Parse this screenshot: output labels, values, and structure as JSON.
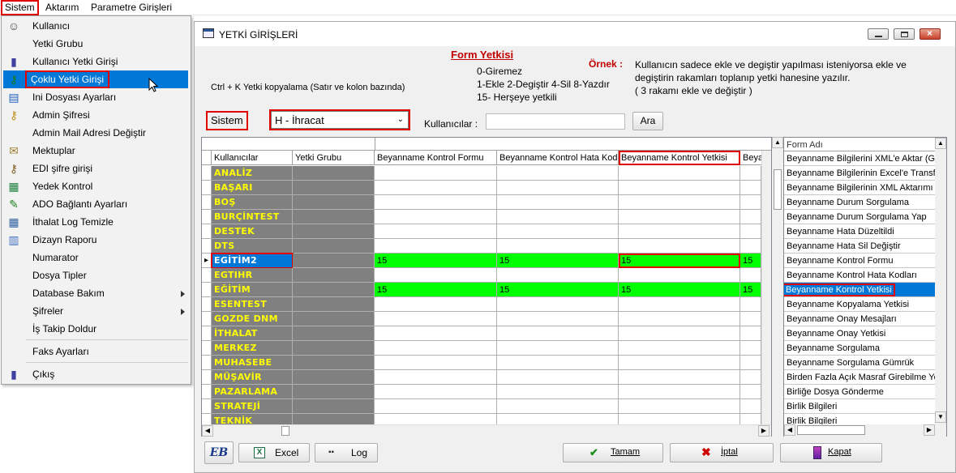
{
  "menubar": {
    "items": [
      "Sistem",
      "Aktarım",
      "Parametre Girişleri"
    ]
  },
  "dropdown": {
    "items": [
      {
        "label": "Kullanıcı",
        "icon": "user-icon"
      },
      {
        "label": "Yetki Grubu",
        "icon": ""
      },
      {
        "label": "Kullanıcı Yetki Girişi",
        "icon": "user-key-icon"
      },
      {
        "label": "Çoklu Yetki Girişi",
        "icon": "multi-key-icon"
      },
      {
        "label": "Ini Dosyası  Ayarları",
        "icon": "ini-file-icon"
      },
      {
        "label": "Admin Şifresi",
        "icon": "key-icon"
      },
      {
        "label": "Admin Mail Adresi Değiştir",
        "icon": ""
      },
      {
        "label": "Mektuplar",
        "icon": "mail-icon"
      },
      {
        "label": "EDI şifre girişi",
        "icon": "edi-key-icon"
      },
      {
        "label": "Yedek Kontrol",
        "icon": "backup-icon"
      },
      {
        "label": "ADO Bağlantı Ayarları",
        "icon": "connection-icon"
      },
      {
        "label": "İthalat Log Temizle",
        "icon": "log-clean-icon"
      },
      {
        "label": "Dizayn Raporu",
        "icon": "report-icon"
      },
      {
        "label": "Numarator",
        "icon": ""
      },
      {
        "label": "Dosya Tipler",
        "icon": ""
      },
      {
        "label": "Database Bakım",
        "icon": "",
        "submenu": true
      },
      {
        "label": "Şifreler",
        "icon": "",
        "submenu": true
      },
      {
        "label": "İş Takip Doldur",
        "icon": ""
      },
      {
        "label": "Faks Ayarları",
        "icon": ""
      },
      {
        "label": "Çıkış",
        "icon": "exit-icon"
      }
    ]
  },
  "window": {
    "title": "YETKİ GİRİŞLERİ",
    "form_yetkisi_title": "Form Yetkisi",
    "legend": [
      "0-Giremez",
      "1-Ekle  2-Degiştir  4-Sil  8-Yazdır",
      "15- Herşeye yetkili"
    ],
    "ornek_label": "Örnek :",
    "ornek_text_1": "Kullanıcın sadece ekle ve degiştir yapılması isteniyorsa  ekle ve",
    "ornek_text_2": "degiştirin rakamları toplanıp yetki hanesine yazılır.",
    "ornek_text_3": " ( 3 rakamı ekle ve değiştir )",
    "copy_hint": "Ctrl + K Yetki kopyalama (Satır ve kolon bazında)",
    "sistem_label": "Sistem",
    "module_value": "H - İhracat",
    "kullanicilar_label": "Kullanıcılar :",
    "kullanicilar_value": "",
    "ara_button": "Ara"
  },
  "grid": {
    "headers": [
      "Kullanıcılar",
      "Yetki Grubu",
      "Beyanname Kontrol Formu",
      "Beyanname Kontrol Hata Kodla",
      "Beyanname Kontrol Yetkisi",
      "Beyanı"
    ],
    "rows": [
      {
        "user": "ANALİZ",
        "vals": [
          "",
          "",
          "",
          ""
        ]
      },
      {
        "user": "BAŞARI",
        "vals": [
          "",
          "",
          "",
          ""
        ]
      },
      {
        "user": "BOŞ",
        "vals": [
          "",
          "",
          "",
          ""
        ]
      },
      {
        "user": "BURÇİNTEST",
        "vals": [
          "",
          "",
          "",
          ""
        ]
      },
      {
        "user": "DESTEK",
        "vals": [
          "",
          "",
          "",
          ""
        ]
      },
      {
        "user": "DTS",
        "vals": [
          "",
          "",
          "",
          ""
        ]
      },
      {
        "user": "EGİTİM2",
        "vals": [
          "15",
          "15",
          "15",
          "15"
        ],
        "selected": true
      },
      {
        "user": "EGTIHR",
        "vals": [
          "",
          "",
          "",
          ""
        ]
      },
      {
        "user": "EĞİTİM",
        "vals": [
          "15",
          "15",
          "15",
          "15"
        ]
      },
      {
        "user": "ESENTEST",
        "vals": [
          "",
          "",
          "",
          ""
        ]
      },
      {
        "user": "GOZDE DNM",
        "vals": [
          "",
          "",
          "",
          ""
        ]
      },
      {
        "user": "İTHALAT",
        "vals": [
          "",
          "",
          "",
          ""
        ]
      },
      {
        "user": "MERKEZ",
        "vals": [
          "",
          "",
          "",
          ""
        ]
      },
      {
        "user": "MUHASEBE",
        "vals": [
          "",
          "",
          "",
          ""
        ]
      },
      {
        "user": "MÜŞAVİR",
        "vals": [
          "",
          "",
          "",
          ""
        ]
      },
      {
        "user": "PAZARLAMA",
        "vals": [
          "",
          "",
          "",
          ""
        ]
      },
      {
        "user": "STRATEJİ",
        "vals": [
          "",
          "",
          "",
          ""
        ]
      },
      {
        "user": "TEKNİK",
        "vals": [
          "",
          "",
          "",
          ""
        ]
      }
    ]
  },
  "forms": {
    "header": "Form Adı",
    "items": [
      "Beyanname Bilgilerini XML'e Aktar (GE",
      "Beyanname Bilgilerinin Excel'e Transfer",
      "Beyanname Bilgilerinin XML Aktarımı (K",
      "Beyanname Durum Sorgulama",
      "Beyanname Durum Sorgulama Yap",
      "Beyanname Hata Düzeltildi",
      "Beyanname Hata Sil Değiştir",
      "Beyanname Kontrol Formu",
      "Beyanname Kontrol Hata Kodları",
      "Beyanname Kontrol Yetkisi",
      "Beyanname Kopyalama Yetkisi",
      "Beyanname Onay Mesajları",
      "Beyanname Onay Yetkisi",
      "Beyanname Sorgulama",
      "Beyanname Sorgulama Gümrük",
      "Birden Fazla Açık Masraf Girebilme Yet",
      "Birliğe Dosya Gönderme",
      "Birlik Bilgileri",
      "Birlik Bilgileri"
    ],
    "selected_index": 9
  },
  "bottom": {
    "logo_text": "EB",
    "excel": "Excel",
    "log": "Log",
    "tamam": "Tamam",
    "iptal": "İptal",
    "kapat": "Kapat"
  },
  "colors": {
    "selection": "#0078d7",
    "highlight_red": "#e00000",
    "granted": "#00ff00",
    "user_text": "#ffff00",
    "user_bg": "#808080"
  }
}
